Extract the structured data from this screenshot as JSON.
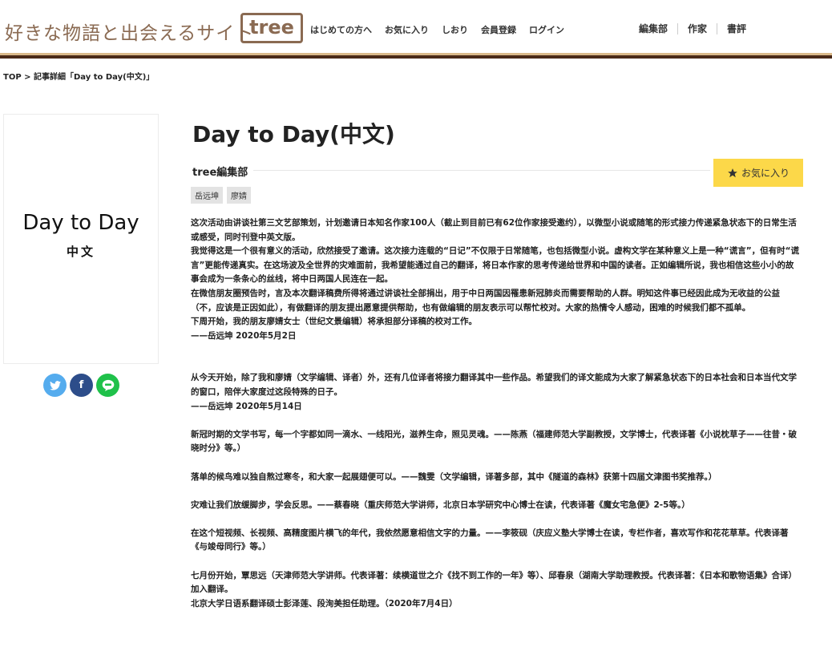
{
  "header": {
    "tagline": "好きな物語と出会えるサイト",
    "logo": "tree",
    "nav": [
      "はじめての方へ",
      "お気に入り",
      "しおり",
      "会員登録",
      "ログイン"
    ],
    "nav_right": [
      "編集部",
      "作家",
      "書評"
    ]
  },
  "breadcrumb": {
    "home": "TOP",
    "separator": " > ",
    "current": "記事詳細「Day to Day(中文)」"
  },
  "cover": {
    "title": "Day to Day",
    "subtitle": "中文"
  },
  "share": {
    "twitter": "twitter-icon",
    "facebook": "facebook-icon",
    "line": "line-icon",
    "colors": {
      "twitter": "#55acee",
      "facebook": "#2d4d8a",
      "line": "#1fc14a"
    }
  },
  "article": {
    "title": "Day to Day(中文)",
    "author": "tree編集部",
    "favorite_label": "お気に入り",
    "tags": [
      "岳远坤",
      "廖婧"
    ],
    "paragraphs": [
      "这次活动由讲谈社第三文艺部策划，计划邀请日本知名作家100人（截止到目前已有62位作家接受邀约），以微型小说或随笔的形式接力传递紧急状态下的日常生活或感受，同时刊登中英文版。",
      "我觉得这是一个很有意义的活动，欣然接受了邀请。这次接力连载的“日记”不仅限于日常随笔，也包括微型小说。虚构文学在某种意义上是一种“谎言”，但有时“谎言”更能传递真实。在这场波及全世界的灾难面前，我希望能通过自己的翻译，将日本作家的思考传递给世界和中国的读者。正如编辑所说，我也相信这些小小的故事会成为一条条心的丝线，将中日两国人民连在一起。",
      "在微信朋友圈预告时，言及本次翻译稿费所得将通过讲谈社全部捐出，用于中日两国因罹患新冠肺炎而需要帮助的人群。明知这件事已经因此成为无收益的公益（不，应该是正因如此），有做翻译的朋友提出愿意提供帮助，也有做编辑的朋友表示可以帮忙校对。大家的热情令人感动，困难的时候我们都不孤单。",
      "下周开始，我的朋友廖婧女士（世纪文景编辑）将承担部分译稿的校对工作。",
      "——岳远坤 2020年5月2日",
      "从今天开始，除了我和廖婧（文学编辑、译者）外，还有几位译者将接力翻译其中一些作品。希望我们的译文能成为大家了解紧急状态下的日本社会和日本当代文学的窗口，陪伴大家度过这段特殊的日子。",
      "——岳远坤 2020年5月14日",
      "新冠时期的文学书写，每一个字都如同一滴水、一线阳光，滋养生命，照见灵魂。——陈燕（福建师范大学副教授，文学博士，代表译著《小说枕草子——往昔・破晓时分》等。）",
      "落单的候鸟难以独自熬过寒冬，和大家一起展翅便可以。——魏雯（文学编辑，译著多部，其中《隧道的森林》获第十四届文津图书奖推荐。）",
      "灾难让我们放缓脚步，学会反思。——蔡春晓（重庆师范大学讲师，北京日本学研究中心博士在读，代表译著《魔女宅急便》2-5等。）",
      "在这个短视频、长视频、高精度图片横飞的年代，我依然愿意相信文字的力量。——李筱砚（庆应义塾大学博士在读，专栏作者，喜欢写作和花花草草。代表译著《与竣母同行》等。）",
      "七月份开始，覃思远（天津师范大学讲师。代表译著：续横道世之介《找不到工作的一年》等）、邱春泉（湖南大学助理教授。代表译著：《日本和歌物语集》合译）加入翻译。",
      "北京大学日语系翻译硕士彭泽莲、段洵美担任助理。（2020年7月4日）"
    ]
  }
}
